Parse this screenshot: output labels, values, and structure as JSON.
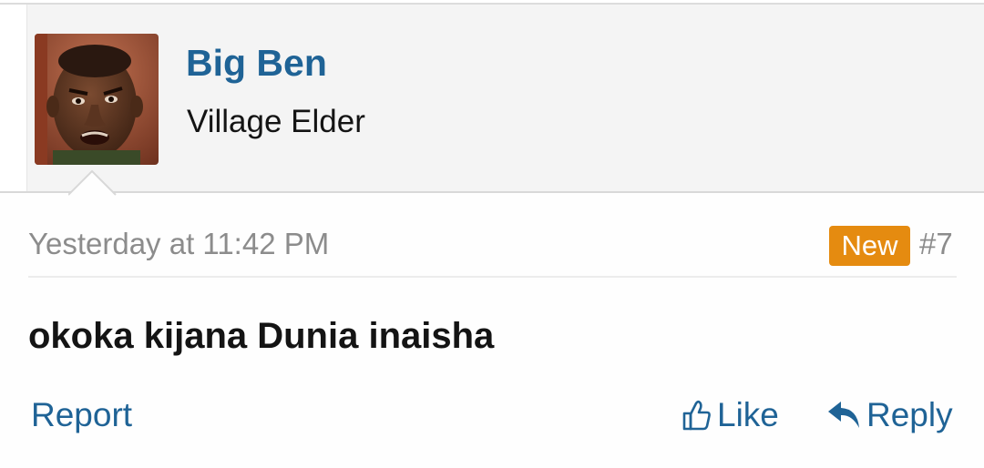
{
  "user": {
    "name": "Big Ben",
    "title": "Village Elder",
    "avatar_icon": "user-avatar-photo"
  },
  "post": {
    "timestamp": "Yesterday at 11:42 PM",
    "badge": "New",
    "number": "#7",
    "message": "okoka kijana Dunia inaisha"
  },
  "actions": {
    "report_label": "Report",
    "like_label": "Like",
    "like_icon": "thumbs-up-icon",
    "reply_label": "Reply",
    "reply_icon": "reply-arrow-icon"
  },
  "colors": {
    "link": "#1f6396",
    "badge": "#e58b10",
    "header_bg": "#f4f4f4",
    "muted_text": "#8c8c8c"
  }
}
